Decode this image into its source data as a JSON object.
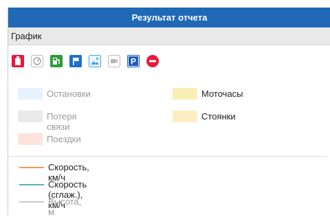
{
  "window": {
    "title": "Результат отчета"
  },
  "section": {
    "label": "График"
  },
  "toolbar": {
    "icons": [
      "fuel-canister-icon",
      "speedometer-icon",
      "fuel-station-icon",
      "flag-icon",
      "image-icon",
      "video-camera-icon",
      "parking-icon",
      "stop-sign-icon"
    ]
  },
  "legend": {
    "areas": [
      {
        "label": "Остановки",
        "color": "#e6f3ff",
        "active": false
      },
      {
        "label": "Моточасы",
        "color": "#f8efb5",
        "active": true
      },
      {
        "label": "Потеря связи",
        "color": "#e9e9e9",
        "active": false
      },
      {
        "label": "Стоянки",
        "color": "#fdeec2",
        "active": true
      },
      {
        "label": "Поездки",
        "color": "#fde3dc",
        "active": false
      }
    ],
    "lines": [
      {
        "label": "Скорость, км/ч",
        "color": "#f39a5b",
        "active": true
      },
      {
        "label": "Скорость (сглаж.), км/ч",
        "color": "#56b2b8",
        "active": true
      },
      {
        "label": "Высота, м",
        "color": "#c9c7df",
        "active": false
      }
    ]
  },
  "colors": {
    "titlebar": "#1f69b6",
    "active_text": "#222222",
    "inactive_text": "#999999"
  }
}
